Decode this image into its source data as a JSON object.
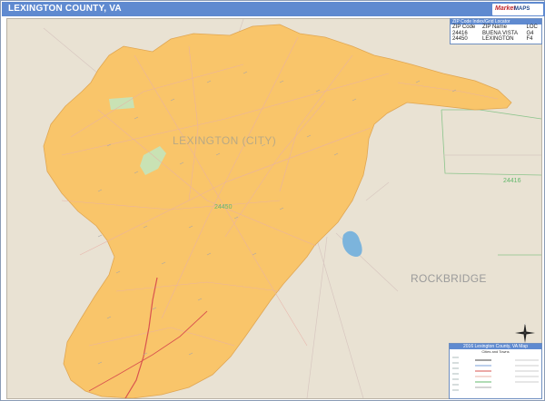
{
  "title": "LEXINGTON COUNTY, VA",
  "logo": {
    "red": "Market",
    "blue": "MAPS"
  },
  "map_labels": {
    "city": "LEXINGTON (CITY)",
    "county": "ROCKBRIDGE",
    "zip_inside": "24450",
    "zip_outside": "24416"
  },
  "zip_table": {
    "title": "ZIP Code Index/Grid Locator",
    "columns": [
      "ZIP Code",
      "ZIP Name",
      "LOC"
    ],
    "rows": [
      [
        "24416",
        "BUENA VISTA",
        "G4"
      ],
      [
        "24450",
        "LEXINGTON",
        "F4"
      ]
    ]
  },
  "legend": {
    "title": "2016 Lexington County, VA Map",
    "subtitle": "Cities and Towns"
  },
  "compass": {
    "north": "N"
  },
  "colors": {
    "city_fill": "#f9c56a",
    "background": "#e9e2d3",
    "water": "#7cb4dc",
    "park": "#c9e2b4",
    "road_major": "#d9534f",
    "road_minor": "#e8b0a6",
    "zip_boundary": "#63b86c",
    "header": "#5f8ad0"
  }
}
